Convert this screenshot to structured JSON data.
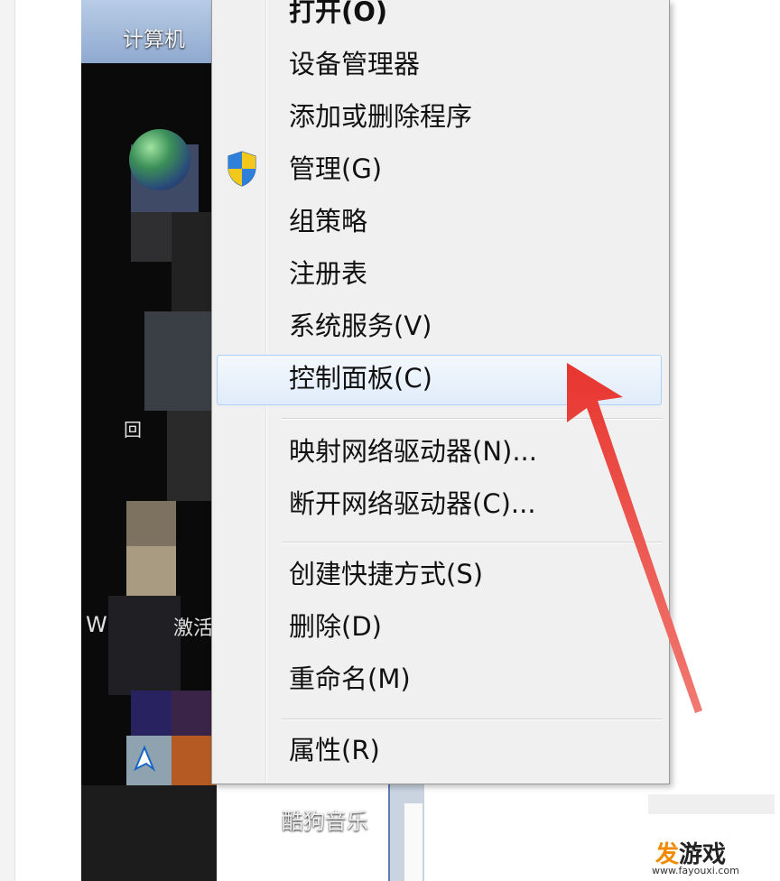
{
  "desktop": {
    "icon_label": "计算机",
    "partial_char_1": "回",
    "partial_char_2": "W",
    "partial_char_3": "激活",
    "bottom_label": "酷狗音乐"
  },
  "context_menu": {
    "items": [
      {
        "label": "打开(O)"
      },
      {
        "label": "设备管理器"
      },
      {
        "label": "添加或删除程序"
      },
      {
        "label": "管理(G)"
      },
      {
        "label": "组策略"
      },
      {
        "label": "注册表"
      },
      {
        "label": "系统服务(V)"
      },
      {
        "label": "控制面板(C)"
      },
      {
        "label": "映射网络驱动器(N)..."
      },
      {
        "label": "断开网络驱动器(C)..."
      },
      {
        "label": "创建快捷方式(S)"
      },
      {
        "label": "删除(D)"
      },
      {
        "label": "重命名(M)"
      },
      {
        "label": "属性(R)"
      }
    ],
    "highlighted_item": "控制面板(C)",
    "highlight_color": "#e0ecfa",
    "shield_icon": "uac-shield-icon"
  },
  "annotation": {
    "arrow_color": "#e8352f",
    "icon": "red-arrow-icon"
  },
  "watermark": {
    "brand_fa": "发",
    "brand_rest": "游戏",
    "url": "www.fayouxi.com"
  }
}
